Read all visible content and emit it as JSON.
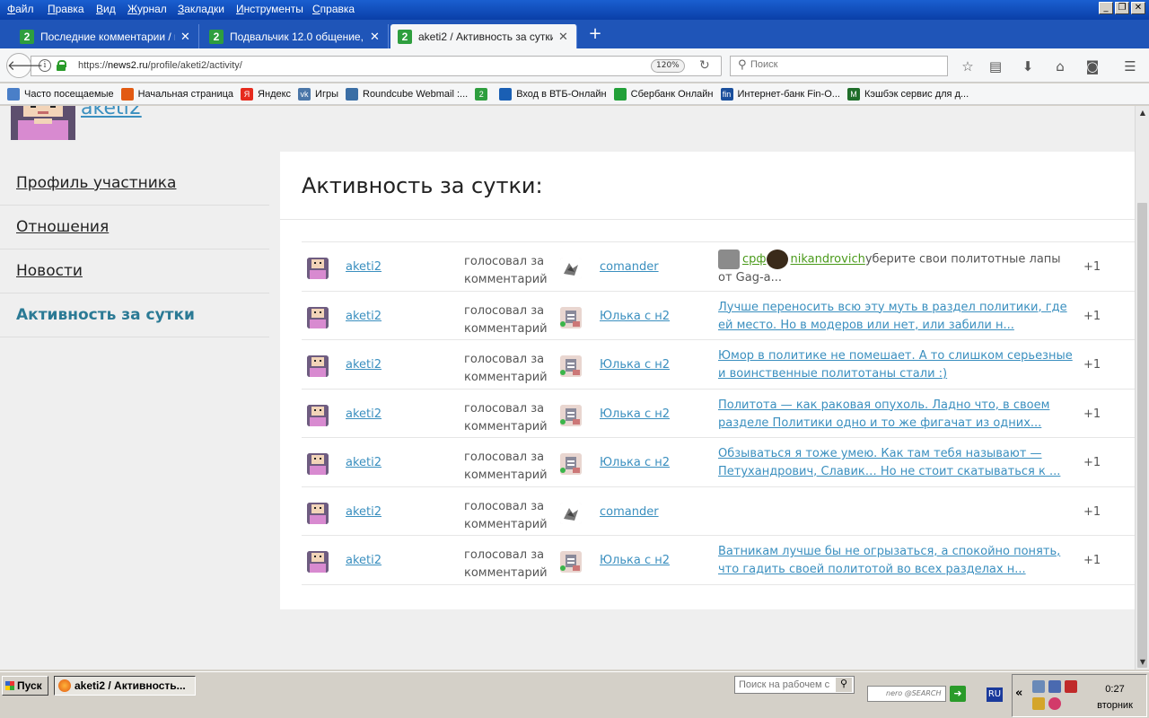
{
  "menubar": {
    "items": [
      "Файл",
      "Правка",
      "Вид",
      "Журнал",
      "Закладки",
      "Инструменты",
      "Справка"
    ]
  },
  "tabs": [
    {
      "title": "Последние комментарии / n...",
      "favicon": "2"
    },
    {
      "title": "Подвальчик 12.0 общение, с...",
      "favicon": "2"
    },
    {
      "title": "aketi2 / Активность за сутки...",
      "favicon": "2"
    }
  ],
  "navbar": {
    "url_prefix": "https://",
    "url_host": "news2.ru",
    "url_path": "/profile/aketi2/activity/",
    "zoom": "120%",
    "search_placeholder": "Поиск"
  },
  "bookmarks": [
    {
      "label": "Часто посещаемые",
      "icon": "folder-icon",
      "color": "#4a7fc8"
    },
    {
      "label": "Начальная страница",
      "icon": "firefox-icon",
      "color": "#e25a12"
    },
    {
      "label": "Яндекс",
      "icon": "yandex-icon",
      "color": "#e62b1e",
      "glyph": "Я"
    },
    {
      "label": "Игры",
      "icon": "vk-icon",
      "color": "#4a76a8",
      "glyph": "vk"
    },
    {
      "label": "Roundcube Webmail :...",
      "icon": "roundcube-icon",
      "color": "#3a6ea5"
    },
    {
      "label": "",
      "icon": "news2-icon",
      "color": "#2e9e3e",
      "glyph": "2"
    },
    {
      "label": "Вход в ВТБ-Онлайн",
      "icon": "vtb-icon",
      "color": "#1a5fb4"
    },
    {
      "label": "Сбербанк Онлайн",
      "icon": "sberbank-icon",
      "color": "#21a038"
    },
    {
      "label": "Интернет-банк Fin-O...",
      "icon": "fin-icon",
      "color": "#1a4f9c",
      "glyph": "fin"
    },
    {
      "label": "Кэшбэк сервис для д...",
      "icon": "cashback-icon",
      "color": "#1f6e2a",
      "glyph": "M"
    }
  ],
  "profile": {
    "username": "aketi2"
  },
  "sidebar": {
    "items": [
      {
        "label": "Профиль участника"
      },
      {
        "label": "Отношения"
      },
      {
        "label": "Новости"
      },
      {
        "label": "Активность за сутки"
      }
    ]
  },
  "activity": {
    "title": "Активность за сутки:",
    "rows": [
      {
        "actor": "aketi2",
        "action": "голосовал за комментарий",
        "target": "comander",
        "online": false,
        "comment": "",
        "comment_user1": "срф",
        "comment_user2": "nikandrovich",
        "comment_rest": "уберите свои политотные лапы от Gag-a...",
        "score": "+1"
      },
      {
        "actor": "aketi2",
        "action": "голосовал за комментарий",
        "target": "Юлька с н2",
        "online": true,
        "comment": "Лучше переносить всю эту муть в раздел политики, где ей место. Но в модеров или нет, или забили н...",
        "score": "+1"
      },
      {
        "actor": "aketi2",
        "action": "голосовал за комментарий",
        "target": "Юлька с н2",
        "online": true,
        "comment": "Юмор в политике не помешает. А то слишком серьезные и воинственные политотаны стали :)",
        "score": "+1"
      },
      {
        "actor": "aketi2",
        "action": "голосовал за комментарий",
        "target": "Юлька с н2",
        "online": true,
        "comment": "Политота — как раковая опухоль. Ладно что, в своем разделе Политики одно и то же фигачат из одних...",
        "score": "+1"
      },
      {
        "actor": "aketi2",
        "action": "голосовал за комментарий",
        "target": "Юлька с н2",
        "online": true,
        "comment": "Обзываться я тоже умею. Как там тебя называют — Петухандрович, Славик… Но не стоит скатываться к ...",
        "score": "+1"
      },
      {
        "actor": "aketi2",
        "action": "голосовал за комментарий",
        "target": "comander",
        "online": false,
        "comment": "",
        "score": "+1"
      },
      {
        "actor": "aketi2",
        "action": "голосовал за комментарий",
        "target": "Юлька с н2",
        "online": true,
        "comment": "Ватникам лучше бы не огрызаться, а спокойно понять, что гадить своей политотой во всех разделах н...",
        "score": "+1"
      }
    ]
  },
  "taskbar": {
    "start": "Пуск",
    "task": "aketi2 / Активность...",
    "desk_search_placeholder": "Поиск на рабочем с",
    "nero_label": "nero @SEARCH",
    "lang": "RU",
    "time": "0:27",
    "day": "вторник"
  }
}
